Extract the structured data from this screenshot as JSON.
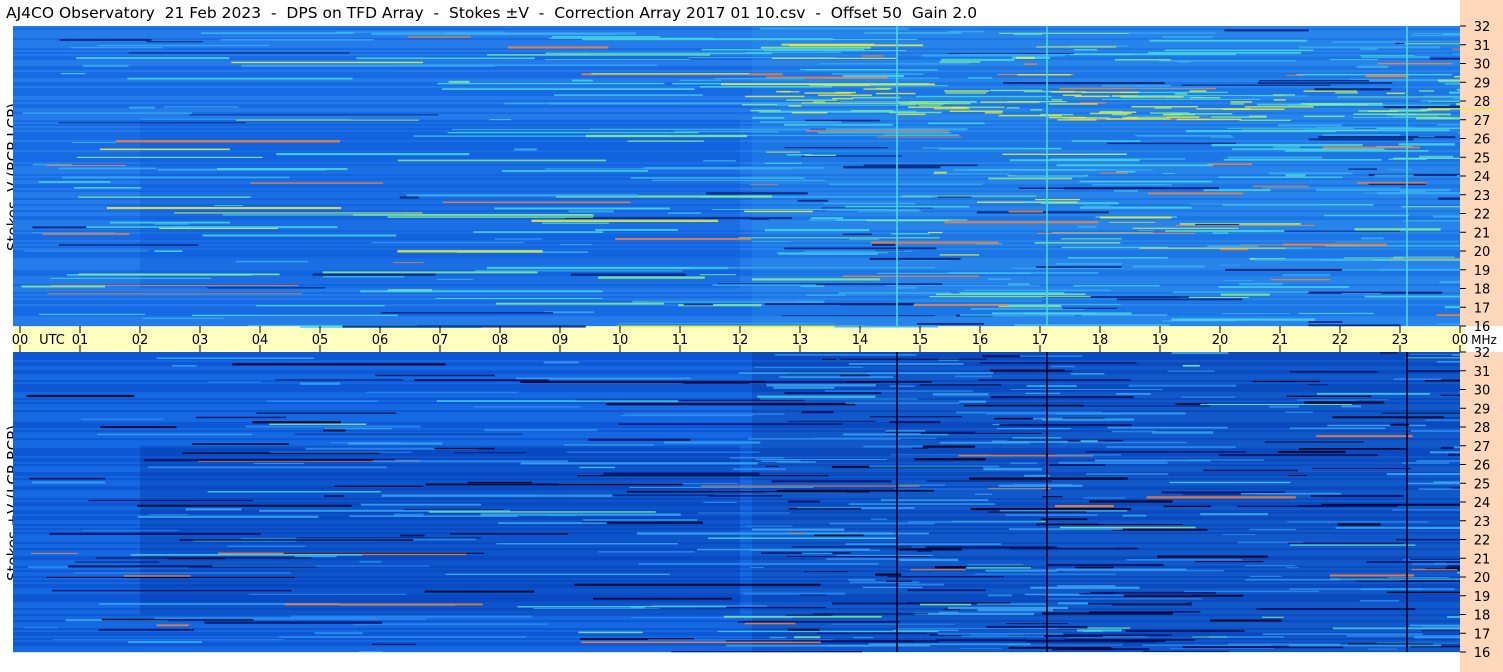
{
  "header": {
    "title": "AJ4CO Observatory  21 Feb 2023  -  DPS on TFD Array  -  Stokes ±V  -  Correction Array 2017 01 10.csv  -  Offset 50  Gain 2.0"
  },
  "chart_data": {
    "type": "heatmap",
    "title": "AJ4CO Observatory  21 Feb 2023  -  DPS on TFD Array  -  Stokes ±V  -  Correction Array 2017 01 10.csv  -  Offset 50  Gain 2.0",
    "x_axis": {
      "label": "UTC",
      "unit_label": "MHz",
      "ticks": [
        "00",
        "01",
        "02",
        "03",
        "04",
        "05",
        "06",
        "07",
        "08",
        "09",
        "10",
        "11",
        "12",
        "13",
        "14",
        "15",
        "16",
        "17",
        "18",
        "19",
        "20",
        "21",
        "22",
        "23",
        "00"
      ],
      "range": [
        0,
        24
      ]
    },
    "y_axis": {
      "unit": "MHz",
      "range": [
        16,
        32
      ],
      "ticks": [
        16,
        17,
        18,
        19,
        20,
        21,
        22,
        23,
        24,
        25,
        26,
        27,
        28,
        29,
        30,
        31,
        32
      ]
    },
    "panels": [
      {
        "name": "top",
        "ylabel": "Stokes -V (RCP-LCP)",
        "colors": [
          "#00207a",
          "#0038c0",
          "#0a56d8",
          "#1570e6",
          "#2d8cf0",
          "#3aaef0",
          "#47d8e0",
          "#88ee90",
          "#e8f040",
          "#ff8030"
        ]
      },
      {
        "name": "bottom",
        "ylabel": "Stokes +V (LCP-RCP)",
        "colors": [
          "#000020",
          "#001060",
          "#0030a0",
          "#0a50d0",
          "#1670e6",
          "#2a8cf0",
          "#3aa8f0",
          "#48d0e6",
          "#80ee9a",
          "#ff8030"
        ]
      }
    ],
    "grid": false
  }
}
